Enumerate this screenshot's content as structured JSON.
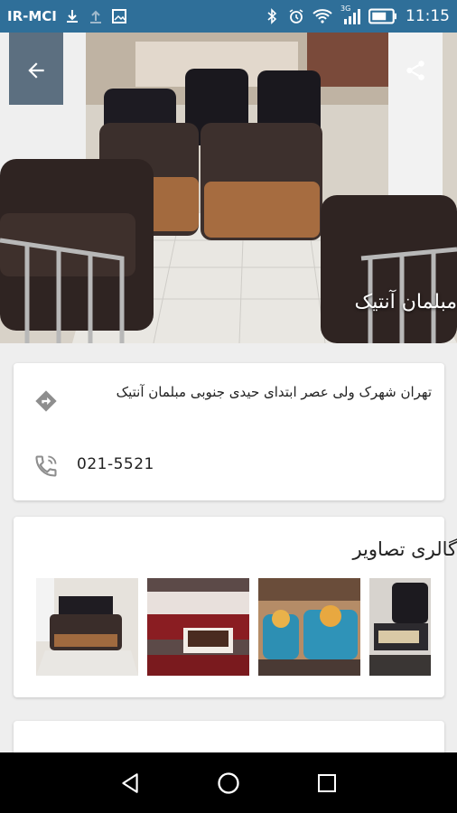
{
  "status_bar": {
    "carrier": "IR-MCI",
    "network_label": "3G",
    "time": "11:15"
  },
  "hero": {
    "title": "مبلمان آنتیک",
    "back_icon": "arrow-back-icon",
    "share_icon": "share-icon"
  },
  "info": {
    "address": "تهران شهرک ولی عصر ابتدای حیدی جنوبی مبلمان آنتیک",
    "phone": "021-5521",
    "address_icon": "directions-icon",
    "phone_icon": "phone-icon"
  },
  "gallery": {
    "title": "گالری تصاویر",
    "images": [
      "sofa-showroom-photo",
      "red-sectional-photo",
      "turquoise-sofa-photo",
      "dark-chair-photo"
    ]
  },
  "nav": {
    "back": "nav-back-icon",
    "home": "nav-home-icon",
    "recents": "nav-recents-icon"
  },
  "colors": {
    "status_bar": "#2f6f99",
    "background": "#eeeeee",
    "nav_bar": "#000000"
  }
}
